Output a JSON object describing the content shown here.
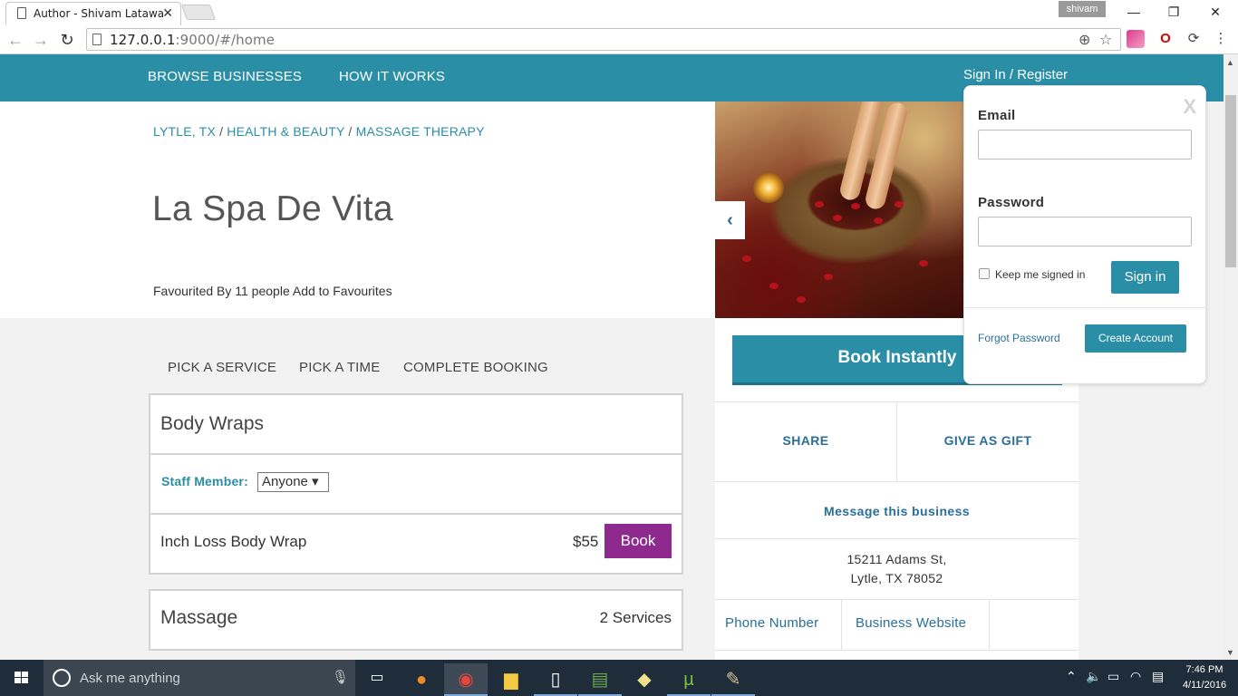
{
  "browser": {
    "tab_title": "Author - Shivam Latawa",
    "tab_close": "✕",
    "profile_name": "shivam",
    "window_minimize": "—",
    "window_restore": "❐",
    "window_close": "✕",
    "url_host": "127.0.0.1",
    "url_rest": ":9000/#/home",
    "back_glyph": "←",
    "forward_glyph": "→",
    "reload_glyph": "↻",
    "zoom_glyph": "⊕",
    "star_glyph": "☆",
    "menu_glyph": "⋮"
  },
  "header": {
    "nav": [
      "BROWSE BUSINESSES",
      "HOW IT WORKS"
    ],
    "signin": "Sign In / Register"
  },
  "business": {
    "breadcrumb": [
      "LYTLE, TX",
      "HEALTH & BEAUTY",
      "MASSAGE THERAPY"
    ],
    "separator": " / ",
    "name": "La Spa De Vita",
    "favourited": "Favourited By 11 people",
    "add_favourite": "Add to Favourites",
    "carousel_prev": "‹"
  },
  "booking": {
    "steps": [
      "PICK A SERVICE",
      "PICK A TIME",
      "COMPLETE BOOKING"
    ],
    "categories": [
      {
        "name": "Body Wraps",
        "staff_label": "Staff Member:",
        "staff_value": "Anyone ▾",
        "services": [
          {
            "name": "Inch Loss Body Wrap",
            "price": "$55",
            "action": "Book"
          }
        ]
      },
      {
        "name": "Massage",
        "count": "2 Services"
      }
    ]
  },
  "sidebar": {
    "book_instantly": "Book Instantly",
    "share": "SHARE",
    "gift": "GIVE AS GIFT",
    "message": "Message this business",
    "address_line1": "15211 Adams St,",
    "address_line2": "Lytle, TX 78052",
    "phone": "Phone Number",
    "website": "Business Website"
  },
  "login": {
    "close": "X",
    "email_label": "Email",
    "email_value": "",
    "password_label": "Password",
    "password_value": "",
    "keep_signed_in": "Keep me signed in",
    "signin_button": "Sign in",
    "forgot": "Forgot Password",
    "create_account": "Create Account"
  },
  "taskbar": {
    "search_placeholder": "Ask me anything",
    "time": "7:46 PM",
    "date": "4/11/2016"
  },
  "colors": {
    "brand_teal": "#2a8ea7",
    "book_purple": "#8e2a8e",
    "link_blue": "#2a6f9a"
  }
}
